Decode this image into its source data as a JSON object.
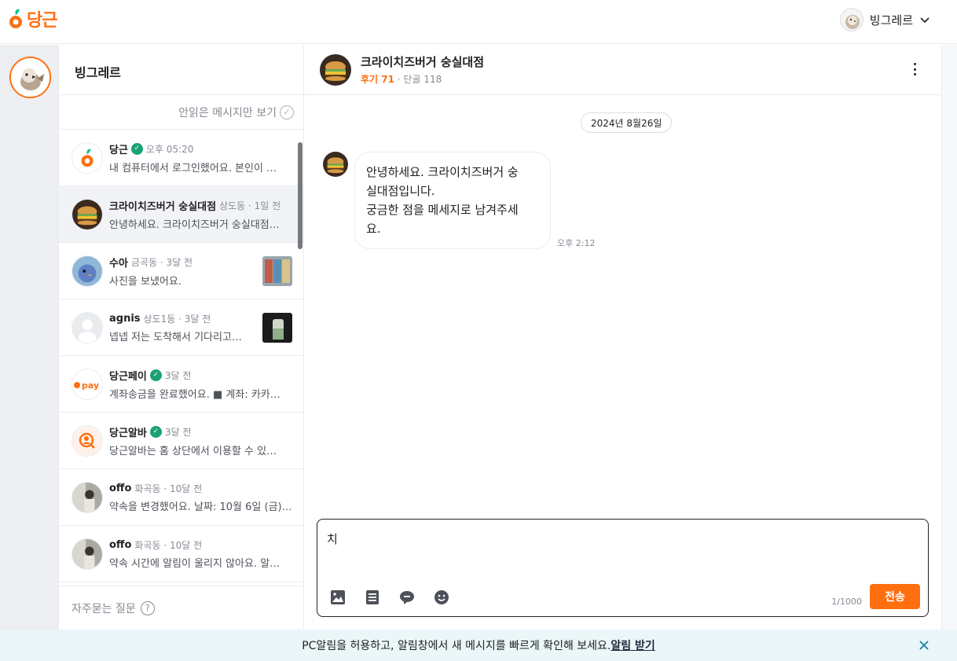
{
  "header": {
    "logo_text": "당근",
    "user_name": "빙그레르",
    "brand_color": "#ff6f0f"
  },
  "chat_list": {
    "title": "빙그레르",
    "unread_toggle": "안읽은 메시지만 보기",
    "faq": "자주묻는 질문",
    "items": [
      {
        "name": "당근",
        "verified": true,
        "meta": "오후 05:20",
        "message": "내 컴퓨터에서 로그인했어요. 본인이 …",
        "avatar": "carrot-logo"
      },
      {
        "name": "크라이치즈버거 숭실대점",
        "verified": false,
        "meta": "상도동 · 1일 전",
        "message": "안녕하세요. 크라이치즈버거 숭실대점…",
        "avatar": "burger"
      },
      {
        "name": "수아",
        "verified": false,
        "meta": "금곡동 · 3달 전",
        "message": "사진을 보냈어요.",
        "avatar": "bird-blue",
        "thumb": "store"
      },
      {
        "name": "agnis",
        "verified": false,
        "meta": "상도1동 · 3달 전",
        "message": "넵넵 저는 도착해서 기다리고…",
        "avatar": "default",
        "thumb": "drink"
      },
      {
        "name": "당근페이",
        "verified": true,
        "meta": "3달 전",
        "message": "계좌송금을 완료했어요. ■ 계좌: 카카…",
        "avatar": "pay"
      },
      {
        "name": "당근알바",
        "verified": true,
        "meta": "3달 전",
        "message": "당근알바는 홈 상단에서 이용할 수 있…",
        "avatar": "alba"
      },
      {
        "name": "offo",
        "verified": false,
        "meta": "화곡동 · 10달 전",
        "message": "약속을 변경했어요. 날짜: 10월 6일 (금)…",
        "avatar": "photo"
      },
      {
        "name": "offo",
        "verified": false,
        "meta": "화곡동 · 10달 전",
        "message": "약속 시간에 알림이 울리지 않아요. 알…",
        "avatar": "photo"
      }
    ]
  },
  "conversation": {
    "title": "크라이치즈버거 숭실대점",
    "reviews_label": "후기 71",
    "regulars_label": " · 단골 118",
    "date": "2024년 8월26일",
    "message_line1": "안녕하세요. 크라이치즈버거 숭",
    "message_line2": "실대점입니다.",
    "message_line3": "궁금한 점을 메세지로 남겨주세",
    "message_line4": "요.",
    "message_time": "오후 2:12"
  },
  "composer": {
    "value": "치",
    "counter": "1/1000",
    "send_label": "전송"
  },
  "notice": {
    "text": "PC알림을 허용하고, 알림창에서 새 메시지를 빠르게 확인해 보세요.",
    "link": "알림 받기"
  }
}
